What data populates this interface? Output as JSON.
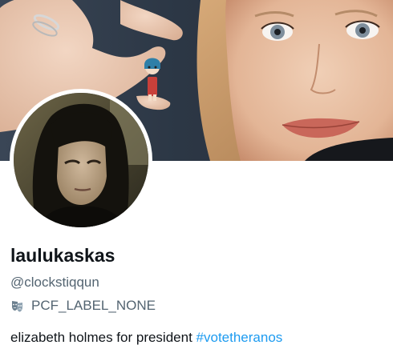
{
  "profile": {
    "display_name": "laulukaskas",
    "handle": "@clockstiqqun",
    "label": "PCF_LABEL_NONE",
    "label_icon": "theater-mask-icon",
    "bio_text": "elizabeth holmes for president ",
    "bio_hashtag": "#votetheranos"
  },
  "colors": {
    "text_primary": "#0f1419",
    "text_secondary": "#536471",
    "link": "#1d9bf0"
  }
}
